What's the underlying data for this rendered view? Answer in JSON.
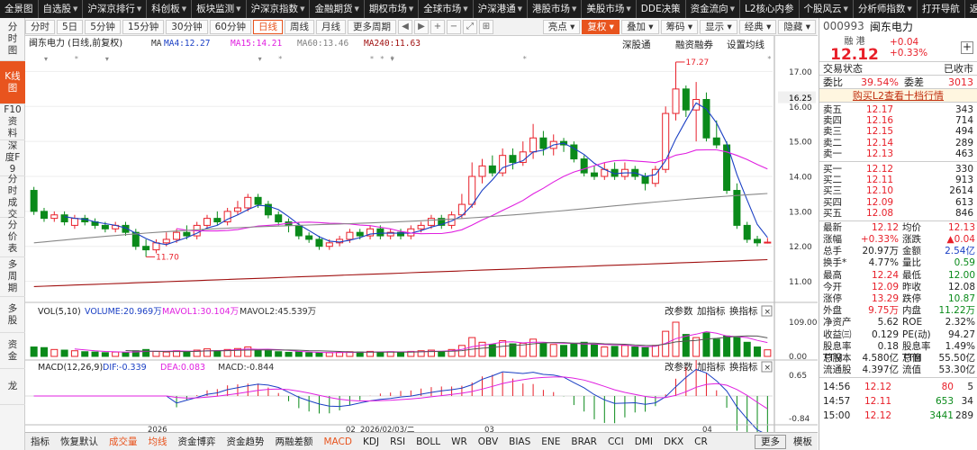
{
  "topnav": [
    {
      "label": "全景图",
      "dd": false
    },
    {
      "label": "自选股",
      "dd": true
    },
    {
      "label": "沪深京排行",
      "dd": true
    },
    {
      "label": "科创板",
      "dd": true
    },
    {
      "label": "板块监测",
      "dd": true
    },
    {
      "label": "沪深京指数",
      "dd": true
    },
    {
      "label": "金融期货",
      "dd": true
    },
    {
      "label": "期权市场",
      "dd": true
    },
    {
      "label": "全球市场",
      "dd": true
    },
    {
      "label": "沪深港通",
      "dd": true
    },
    {
      "label": "港股市场",
      "dd": true
    },
    {
      "label": "美股市场",
      "dd": true
    },
    {
      "label": "DDE决策",
      "dd": false
    },
    {
      "label": "资金流向",
      "dd": true
    },
    {
      "label": "L2核心内参",
      "dd": false
    },
    {
      "label": "个股风云",
      "dd": true
    },
    {
      "label": "分析师指数",
      "dd": true
    },
    {
      "label": "打开导航",
      "dd": false
    },
    {
      "label": "返回",
      "dd": false
    }
  ],
  "lefttabs": [
    "分时图",
    "K线图",
    "F10资料",
    "深度F9",
    "分时成交",
    "分价表",
    "多周期",
    "多股",
    "资金",
    "龙"
  ],
  "toolbar": {
    "periods": [
      "分时",
      "5日",
      "5分钟",
      "15分钟",
      "30分钟",
      "60分钟",
      "日线",
      "周线",
      "月线",
      "更多周期"
    ],
    "right": [
      "亮点",
      "复权",
      "叠加",
      "筹码",
      "显示",
      "经典",
      "隐藏"
    ]
  },
  "chart_data": {
    "type": "candlestick",
    "title": "闽东电力 (日线,前复权)",
    "ma_legend": [
      {
        "name": "MA",
        "value": "",
        "color": "#333333"
      },
      {
        "name": "MA4",
        "value": "12.27",
        "color": "#1a3fc4"
      },
      {
        "name": "MA15",
        "value": "14.21",
        "color": "#e020e0"
      },
      {
        "name": "MA60",
        "value": "13.46",
        "color": "#808080"
      },
      {
        "name": "MA240",
        "value": "11.63",
        "color": "#a01010"
      }
    ],
    "price_axis": {
      "ticks": [
        17.0,
        16.0,
        15.0,
        14.0,
        13.0,
        12.0,
        11.0
      ],
      "min": 10.5,
      "max": 17.5,
      "current": "16.25"
    },
    "high_marker": "17.27",
    "low_marker": "11.70",
    "candles": [
      [
        13.6,
        13.0,
        13.7,
        12.9
      ],
      [
        13.0,
        12.8,
        13.1,
        12.7
      ],
      [
        12.8,
        12.9,
        13.0,
        12.7
      ],
      [
        12.9,
        12.7,
        13.0,
        12.6
      ],
      [
        12.6,
        12.8,
        12.9,
        12.5
      ],
      [
        12.8,
        12.7,
        12.9,
        12.6
      ],
      [
        12.7,
        12.6,
        12.8,
        12.5
      ],
      [
        12.6,
        12.5,
        12.7,
        12.4
      ],
      [
        12.5,
        12.6,
        12.7,
        12.4
      ],
      [
        12.6,
        12.4,
        12.7,
        12.3
      ],
      [
        12.4,
        12.0,
        12.5,
        11.9
      ],
      [
        12.0,
        11.9,
        12.2,
        11.7
      ],
      [
        11.9,
        12.1,
        12.2,
        11.8
      ],
      [
        12.1,
        12.2,
        12.4,
        12.0
      ],
      [
        12.2,
        12.4,
        12.5,
        12.1
      ],
      [
        12.4,
        12.3,
        12.6,
        12.2
      ],
      [
        12.3,
        12.6,
        12.7,
        12.2
      ],
      [
        12.6,
        12.8,
        12.9,
        12.5
      ],
      [
        12.8,
        12.7,
        13.0,
        12.6
      ],
      [
        12.7,
        13.0,
        13.1,
        12.6
      ],
      [
        13.0,
        13.1,
        13.3,
        12.9
      ],
      [
        13.1,
        13.4,
        13.5,
        13.0
      ],
      [
        13.4,
        13.2,
        13.5,
        13.1
      ],
      [
        13.2,
        12.9,
        13.3,
        12.8
      ],
      [
        12.9,
        12.7,
        13.0,
        12.6
      ],
      [
        12.7,
        12.6,
        12.8,
        12.4
      ],
      [
        12.6,
        12.3,
        12.7,
        12.2
      ],
      [
        12.3,
        12.2,
        12.4,
        12.1
      ],
      [
        12.2,
        12.0,
        12.3,
        11.9
      ],
      [
        12.0,
        12.1,
        12.2,
        11.9
      ],
      [
        12.1,
        12.2,
        12.3,
        12.0
      ],
      [
        12.2,
        12.4,
        12.5,
        12.1
      ],
      [
        12.4,
        12.3,
        12.5,
        12.2
      ],
      [
        12.3,
        12.5,
        12.6,
        12.2
      ],
      [
        12.5,
        12.3,
        12.6,
        12.2
      ],
      [
        12.3,
        12.4,
        12.5,
        12.2
      ],
      [
        12.4,
        12.3,
        12.5,
        12.2
      ],
      [
        12.3,
        12.5,
        12.6,
        12.2
      ],
      [
        12.5,
        12.6,
        12.7,
        12.4
      ],
      [
        12.6,
        12.8,
        12.9,
        12.5
      ],
      [
        12.8,
        12.6,
        12.9,
        12.5
      ],
      [
        12.6,
        12.9,
        13.0,
        12.5
      ],
      [
        12.9,
        13.2,
        13.5,
        12.8
      ],
      [
        13.2,
        14.0,
        14.4,
        13.1
      ],
      [
        14.0,
        14.3,
        14.5,
        13.8
      ],
      [
        14.3,
        14.1,
        14.6,
        14.0
      ],
      [
        14.1,
        14.6,
        14.8,
        14.0
      ],
      [
        14.6,
        14.4,
        14.8,
        14.2
      ],
      [
        14.4,
        14.7,
        15.0,
        14.3
      ],
      [
        14.7,
        15.1,
        15.5,
        14.5
      ],
      [
        15.1,
        14.8,
        15.3,
        14.6
      ],
      [
        14.8,
        15.0,
        15.2,
        14.6
      ],
      [
        15.0,
        14.9,
        15.1,
        14.7
      ],
      [
        14.9,
        14.5,
        15.0,
        14.4
      ],
      [
        14.5,
        14.1,
        14.6,
        14.0
      ],
      [
        14.1,
        14.0,
        14.3,
        13.9
      ],
      [
        14.0,
        14.2,
        14.4,
        13.9
      ],
      [
        14.2,
        14.0,
        14.4,
        13.9
      ],
      [
        14.0,
        14.2,
        14.4,
        13.9
      ],
      [
        14.2,
        14.0,
        14.3,
        13.9
      ],
      [
        14.0,
        13.8,
        14.1,
        13.6
      ],
      [
        13.8,
        14.2,
        14.3,
        13.7
      ],
      [
        14.2,
        15.8,
        16.0,
        14.1
      ],
      [
        15.8,
        16.5,
        17.27,
        15.6
      ],
      [
        16.5,
        15.9,
        16.6,
        15.7
      ],
      [
        15.9,
        16.2,
        16.7,
        15.0
      ],
      [
        16.2,
        15.1,
        16.4,
        15.0
      ],
      [
        15.1,
        14.9,
        15.6,
        14.8
      ],
      [
        14.9,
        13.6,
        15.0,
        13.5
      ],
      [
        13.6,
        12.6,
        13.8,
        12.5
      ],
      [
        12.6,
        12.2,
        12.7,
        12.1
      ],
      [
        12.2,
        12.1,
        12.3,
        12.0
      ],
      [
        12.1,
        12.12,
        12.24,
        12.08
      ]
    ],
    "volume": {
      "label": "VOL(5,10)",
      "ticks": [
        "109.00",
        "0.00"
      ],
      "legend": [
        {
          "name": "VOLUME",
          "value": "20.969万",
          "color": "#1a3fc4"
        },
        {
          "name": "MAVOL1",
          "value": "30.104万",
          "color": "#e020e0"
        },
        {
          "name": "MAVOL2",
          "value": "45.539万",
          "color": "#333333"
        }
      ],
      "values": [
        30,
        28,
        22,
        20,
        18,
        15,
        14,
        12,
        14,
        13,
        18,
        22,
        16,
        14,
        18,
        15,
        20,
        24,
        16,
        22,
        25,
        30,
        20,
        18,
        15,
        13,
        14,
        12,
        11,
        12,
        13,
        15,
        14,
        16,
        14,
        15,
        13,
        16,
        18,
        20,
        16,
        22,
        35,
        60,
        45,
        38,
        50,
        40,
        42,
        55,
        40,
        38,
        35,
        40,
        45,
        38,
        30,
        32,
        35,
        30,
        28,
        35,
        80,
        109,
        70,
        60,
        75,
        55,
        65,
        60,
        45,
        30,
        21
      ]
    },
    "macd": {
      "label": "MACD(12,26,9)",
      "ticks": [
        "0.65",
        "-0.84"
      ],
      "legend": [
        {
          "name": "DIF",
          "value": "-0.339",
          "color": "#1a3fc4"
        },
        {
          "name": "DEA",
          "value": "0.083",
          "color": "#e020e0"
        },
        {
          "name": "MACD",
          "value": "-0.844",
          "color": "#333333"
        }
      ]
    },
    "x_labels": [
      "2026",
      "02",
      "2026/02/03/二",
      "03",
      "04"
    ],
    "panel_buttons": [
      "深股通",
      "融资融券",
      "设置均线"
    ],
    "vol_buttons": [
      "改参数",
      "加指标",
      "换指标"
    ]
  },
  "bottomtabs": [
    "指标",
    "恢复默认",
    "成交量",
    "均线",
    "资金博弈",
    "资金趋势",
    "两融差额",
    "MACD",
    "KDJ",
    "RSI",
    "BOLL",
    "WR",
    "OBV",
    "BIAS",
    "ENE",
    "BRAR",
    "CCI",
    "DMI",
    "DKX",
    "CR",
    "更多",
    "模板"
  ],
  "quote": {
    "code": "000993",
    "name": "闽东电力",
    "tag": "融  港",
    "price": "12.12",
    "chg": "+0.04",
    "pct": "+0.33%",
    "status_label": "交易状态",
    "status": "已收市",
    "weibi_k": "委比",
    "weibi": "39.54%",
    "weicha_k": "委差",
    "weicha": "3013",
    "l2_link": "购买L2查看十档行情",
    "sell": [
      {
        "l": "卖五",
        "p": "12.17",
        "v": "343"
      },
      {
        "l": "卖四",
        "p": "12.16",
        "v": "714"
      },
      {
        "l": "卖三",
        "p": "12.15",
        "v": "494"
      },
      {
        "l": "卖二",
        "p": "12.14",
        "v": "289"
      },
      {
        "l": "卖一",
        "p": "12.13",
        "v": "463"
      }
    ],
    "buy": [
      {
        "l": "买一",
        "p": "12.12",
        "v": "330"
      },
      {
        "l": "买二",
        "p": "12.11",
        "v": "913"
      },
      {
        "l": "买三",
        "p": "12.10",
        "v": "2614"
      },
      {
        "l": "买四",
        "p": "12.09",
        "v": "613"
      },
      {
        "l": "买五",
        "p": "12.08",
        "v": "846"
      }
    ],
    "stats": [
      [
        "最新",
        "12.12",
        "均价",
        "12.13"
      ],
      [
        "涨幅",
        "+0.33%",
        "涨跌",
        "▲0.04"
      ],
      [
        "总手",
        "20.97万",
        "金额",
        "2.54亿"
      ],
      [
        "换手*",
        "4.77%",
        "量比",
        "0.59"
      ],
      [
        "最高",
        "12.24",
        "最低",
        "12.00"
      ],
      [
        "今开",
        "12.09",
        "昨收",
        "12.08"
      ],
      [
        "涨停",
        "13.29",
        "跌停",
        "10.87"
      ],
      [
        "外盘",
        "9.75万",
        "内盘",
        "11.22万"
      ],
      [
        "净资产",
        "5.62",
        "ROE",
        "2.32%"
      ],
      [
        "收益㈢",
        "0.129",
        "PE(动)",
        "94.27"
      ],
      [
        "股息率TTM",
        "0.18",
        "股息率TTM",
        "1.49%"
      ],
      [
        "总股本",
        "4.580亿",
        "总值",
        "55.50亿"
      ],
      [
        "流通股",
        "4.397亿",
        "流值",
        "53.30亿"
      ]
    ],
    "ticks": [
      {
        "t": "14:56",
        "p": "12.12",
        "v": "80",
        "n": "5"
      },
      {
        "t": "14:57",
        "p": "12.11",
        "v": "653",
        "n": "34"
      },
      {
        "t": "15:00",
        "p": "12.12",
        "v": "3441",
        "n": "289"
      }
    ]
  }
}
